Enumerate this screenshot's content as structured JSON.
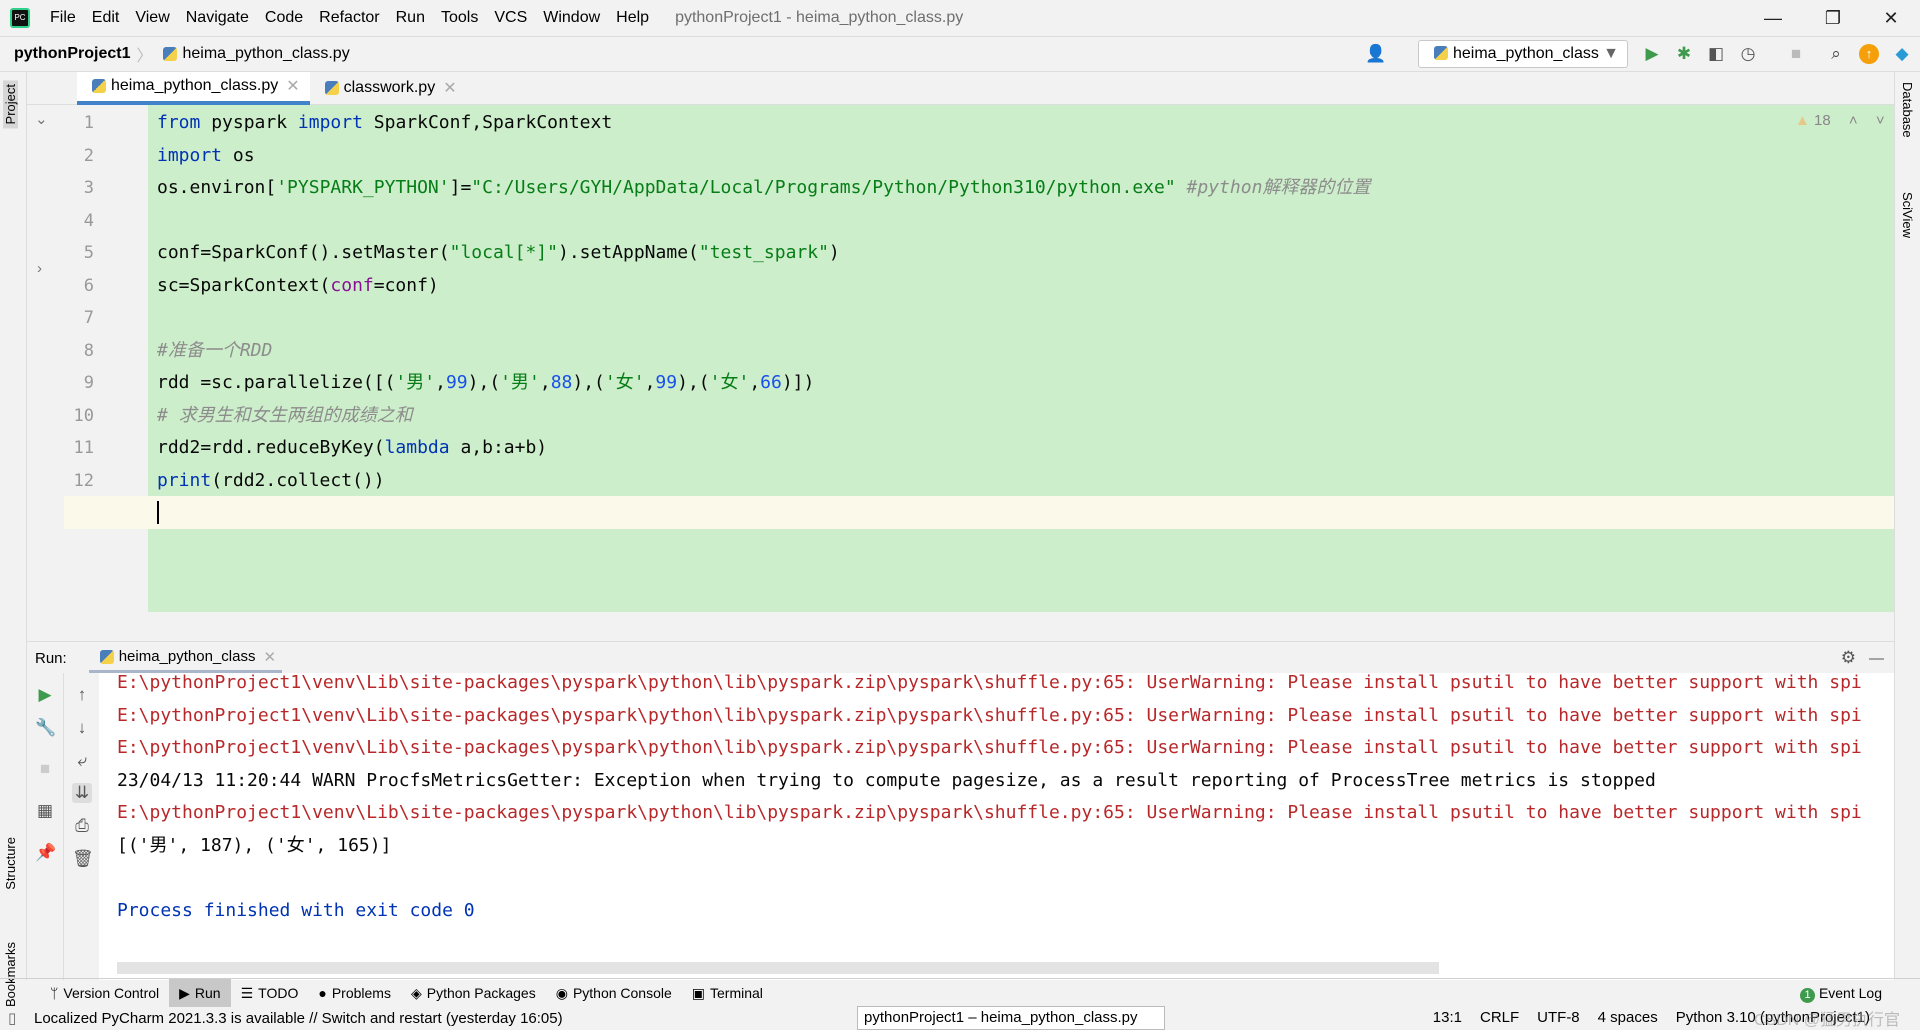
{
  "menubar": {
    "items": [
      "File",
      "Edit",
      "View",
      "Navigate",
      "Code",
      "Refactor",
      "Run",
      "Tools",
      "VCS",
      "Window",
      "Help"
    ],
    "title": "pythonProject1 - heima_python_class.py"
  },
  "navbar": {
    "project": "pythonProject1",
    "file": "heima_python_class.py"
  },
  "toolbar": {
    "run_config": "heima_python_class"
  },
  "tabs": [
    {
      "label": "heima_python_class.py",
      "active": true
    },
    {
      "label": "classwork.py",
      "active": false
    }
  ],
  "side": {
    "project": "Project",
    "structure": "Structure",
    "bookmarks": "Bookmarks",
    "database": "Database",
    "sciview": "SciView"
  },
  "editor": {
    "inspection_count": "18",
    "cursor_line": 13,
    "lines": [
      [
        [
          "from",
          "kw"
        ],
        [
          " pyspark ",
          ""
        ],
        [
          "import",
          "kw"
        ],
        [
          " SparkConf,SparkContext",
          ""
        ]
      ],
      [
        [
          "import",
          "kw"
        ],
        [
          " os",
          ""
        ]
      ],
      [
        [
          "os.environ[",
          ""
        ],
        [
          "'PYSPARK_PYTHON'",
          "str"
        ],
        [
          "]=",
          ""
        ],
        [
          "\"C:/Users/GYH/AppData/Local/Programs/Python/Python310/python.exe\"",
          "str"
        ],
        [
          " ",
          ""
        ],
        [
          "#python解释器的位置",
          "cm"
        ]
      ],
      [],
      [
        [
          "conf=SparkConf().setMaster(",
          ""
        ],
        [
          "\"local[*]\"",
          "str"
        ],
        [
          ").setAppName(",
          ""
        ],
        [
          "\"test_spark\"",
          "str"
        ],
        [
          ")",
          ""
        ]
      ],
      [
        [
          "sc=SparkContext(",
          ""
        ],
        [
          "conf",
          "par"
        ],
        [
          "=conf)",
          ""
        ]
      ],
      [],
      [
        [
          "#准备一个RDD",
          "cm"
        ]
      ],
      [
        [
          "rdd =sc.parallelize([(",
          ""
        ],
        [
          "'男'",
          "str"
        ],
        [
          ",",
          ""
        ],
        [
          "99",
          "num"
        ],
        [
          "),(",
          ""
        ],
        [
          "'男'",
          "str"
        ],
        [
          ",",
          ""
        ],
        [
          "88",
          "num"
        ],
        [
          "),(",
          ""
        ],
        [
          "'女'",
          "str"
        ],
        [
          ",",
          ""
        ],
        [
          "99",
          "num"
        ],
        [
          "),(",
          ""
        ],
        [
          "'女'",
          "str"
        ],
        [
          ",",
          ""
        ],
        [
          "66",
          "num"
        ],
        [
          ")])",
          ""
        ]
      ],
      [
        [
          "# 求男生和女生两组的成绩之和",
          "cm"
        ]
      ],
      [
        [
          "rdd2=rdd.reduceByKey(",
          ""
        ],
        [
          "lambda",
          "kw"
        ],
        [
          " a,b:a+b)",
          ""
        ]
      ],
      [
        [
          "print",
          "kw"
        ],
        [
          "(rdd2.collect())",
          ""
        ]
      ],
      []
    ]
  },
  "run": {
    "label": "Run:",
    "tab": "heima_python_class",
    "output": [
      {
        "text": "E:\\pythonProject1\\venv\\Lib\\site-packages\\pyspark\\python\\lib\\pyspark.zip\\pyspark\\shuffle.py:65: UserWarning: Please install psutil to have better support with spi",
        "type": "err"
      },
      {
        "text": "E:\\pythonProject1\\venv\\Lib\\site-packages\\pyspark\\python\\lib\\pyspark.zip\\pyspark\\shuffle.py:65: UserWarning: Please install psutil to have better support with spi",
        "type": "err"
      },
      {
        "text": "E:\\pythonProject1\\venv\\Lib\\site-packages\\pyspark\\python\\lib\\pyspark.zip\\pyspark\\shuffle.py:65: UserWarning: Please install psutil to have better support with spi",
        "type": "err"
      },
      {
        "text": "23/04/13 11:20:44 WARN ProcfsMetricsGetter: Exception when trying to compute pagesize, as a result reporting of ProcessTree metrics is stopped",
        "type": "out"
      },
      {
        "text": "E:\\pythonProject1\\venv\\Lib\\site-packages\\pyspark\\python\\lib\\pyspark.zip\\pyspark\\shuffle.py:65: UserWarning: Please install psutil to have better support with spi",
        "type": "err"
      },
      {
        "text": "[('男', 187), ('女', 165)]",
        "type": "out"
      },
      {
        "text": "",
        "type": "out"
      },
      {
        "text": "Process finished with exit code 0",
        "type": "fin"
      }
    ]
  },
  "toolwindows": {
    "items": [
      "Version Control",
      "Run",
      "TODO",
      "Problems",
      "Python Packages",
      "Python Console",
      "Terminal"
    ],
    "active": "Run",
    "event_log": "Event Log",
    "event_count": "1"
  },
  "status": {
    "message": "Localized PyCharm 2021.3.3 is available // Switch and restart (yesterday 16:05)",
    "task": "pythonProject1 – heima_python_class.py",
    "position": "13:1",
    "line_sep": "CRLF",
    "encoding": "UTF-8",
    "indent": "4 spaces",
    "interpreter": "Python 3.10 (pythonProject1)",
    "watermark": "CSDN @猛男执行官"
  },
  "colors": {
    "editor_bg": "#cdeecb",
    "keyword": "#0033b3",
    "string": "#067d17",
    "number": "#1750eb",
    "comment": "#8c8c8c",
    "error_output": "#b8282a"
  }
}
